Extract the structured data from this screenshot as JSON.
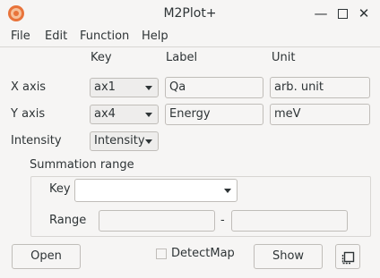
{
  "window": {
    "title": "M2Plot+"
  },
  "icons": {
    "app": "app-logo-icon",
    "minimize": "minimize-icon",
    "maximize": "maximize-icon",
    "close": "close-icon"
  },
  "menu": [
    "File",
    "Edit",
    "Function",
    "Help"
  ],
  "columns": {
    "key": "Key",
    "label": "Label",
    "unit": "Unit"
  },
  "x_axis": {
    "name": "X axis",
    "key": "ax1",
    "label": "Qa",
    "unit": "arb. unit"
  },
  "y_axis": {
    "name": "Y axis",
    "key": "ax4",
    "label": "Energy",
    "unit": "meV"
  },
  "intensity": {
    "name": "Intensity",
    "key": "Intensity"
  },
  "summation": {
    "title": "Summation range",
    "key_label": "Key",
    "key_value": "",
    "range_label": "Range",
    "range_from": "",
    "range_sep": "-",
    "range_to": ""
  },
  "buttons": {
    "open": "Open",
    "show": "Show"
  },
  "detect_map": {
    "label": "DetectMap",
    "checked": false
  }
}
